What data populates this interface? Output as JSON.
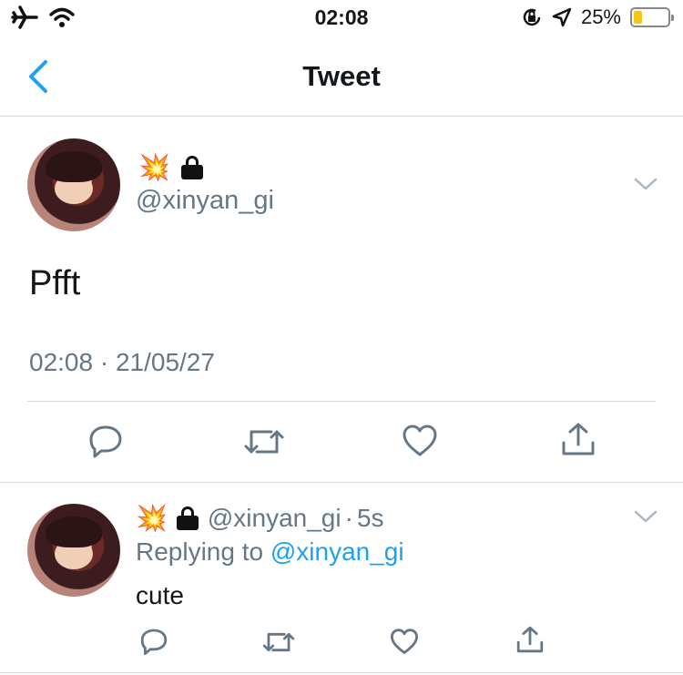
{
  "status_bar": {
    "time": "02:08",
    "battery_percent_label": "25%",
    "battery_level": 0.25,
    "icons": [
      "airplane-icon",
      "wifi-icon",
      "rotation-lock-icon",
      "location-arrow-icon",
      "battery-icon"
    ]
  },
  "nav": {
    "title": "Tweet",
    "back_icon": "chevron-left-icon"
  },
  "tweet": {
    "emoji": "💥",
    "handle": "@xinyan_gi",
    "text": "Pfft",
    "timestamp": "02:08 · 21/05/27",
    "actions": [
      "reply-icon",
      "retweet-icon",
      "like-icon",
      "share-icon"
    ]
  },
  "reply": {
    "emoji": "💥",
    "handle": "@xinyan_gi",
    "dot": "·",
    "age": "5s",
    "replying_prefix": "Replying to",
    "replying_to": "@xinyan_gi",
    "text": "cute",
    "actions": [
      "reply-icon",
      "retweet-icon",
      "like-icon",
      "share-icon"
    ]
  },
  "colors": {
    "accent": "#1da1f2",
    "muted_text": "#657786",
    "divider": "#d6d9db",
    "battery_fill": "#f5c518"
  }
}
